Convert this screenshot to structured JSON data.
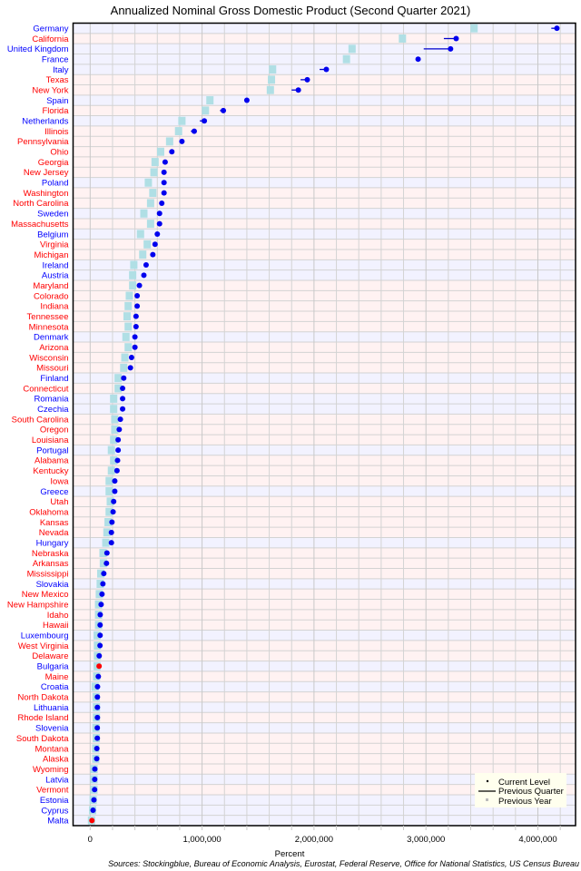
{
  "chart_data": {
    "type": "dot-range",
    "title": "Annualized Nominal Gross Domestic Product (Second Quarter 2021)",
    "xlabel": "Percent",
    "ylabel": "",
    "source": "Sources: Stockingblue, Bureau of Economic Analysis, Eurostat, Federal Reserve, Office for National Statistics, US Census Bureau",
    "xlim": [
      0,
      4300000
    ],
    "xticks": [
      0,
      1000000,
      2000000,
      3000000,
      4000000
    ],
    "xtick_labels": [
      "0",
      "1,000,000",
      "2,000,000",
      "3,000,000",
      "4,000,000"
    ],
    "grid": true,
    "grid_step": 200000,
    "legend": {
      "placement": "bottom-right",
      "items": [
        {
          "label": "Current Level",
          "symbol": "dot"
        },
        {
          "label": "Previous Quarter",
          "symbol": "line"
        },
        {
          "label": "Previous Year",
          "symbol": "square"
        }
      ]
    },
    "colors": {
      "country_label": "#0000ff",
      "state_label": "#ff0000",
      "country_band": "#f2f2ff",
      "state_band": "#fff2f2",
      "current_dot": "#0000ee",
      "current_dot_decline": "#ff0000",
      "previous_quarter_line": "#0000cc",
      "previous_year_square": "#b0dfe5",
      "grid": "#d3d3d3",
      "legend_bg": "#ffffee"
    },
    "series_names": [
      "Current Level",
      "Previous Quarter",
      "Previous Year"
    ],
    "rows": [
      {
        "name": "Germany",
        "kind": "country",
        "current": 4170000,
        "prev_quarter": 4120000,
        "prev_year": 3430000
      },
      {
        "name": "California",
        "kind": "state",
        "current": 3270000,
        "prev_quarter": 3160000,
        "prev_year": 2790000
      },
      {
        "name": "United Kingdom",
        "kind": "country",
        "current": 3220000,
        "prev_quarter": 2980000,
        "prev_year": 2340000
      },
      {
        "name": "France",
        "kind": "country",
        "current": 2930000,
        "prev_quarter": 2910000,
        "prev_year": 2290000
      },
      {
        "name": "Italy",
        "kind": "country",
        "current": 2110000,
        "prev_quarter": 2050000,
        "prev_year": 1630000
      },
      {
        "name": "Texas",
        "kind": "state",
        "current": 1940000,
        "prev_quarter": 1880000,
        "prev_year": 1620000
      },
      {
        "name": "New York",
        "kind": "state",
        "current": 1860000,
        "prev_quarter": 1800000,
        "prev_year": 1610000
      },
      {
        "name": "Spain",
        "kind": "country",
        "current": 1400000,
        "prev_quarter": 1390000,
        "prev_year": 1070000
      },
      {
        "name": "Florida",
        "kind": "state",
        "current": 1190000,
        "prev_quarter": 1160000,
        "prev_year": 1030000
      },
      {
        "name": "Netherlands",
        "kind": "country",
        "current": 1020000,
        "prev_quarter": 980000,
        "prev_year": 820000
      },
      {
        "name": "Illinois",
        "kind": "state",
        "current": 930000,
        "prev_quarter": 900000,
        "prev_year": 790000
      },
      {
        "name": "Pennsylvania",
        "kind": "state",
        "current": 820000,
        "prev_quarter": 810000,
        "prev_year": 710000
      },
      {
        "name": "Ohio",
        "kind": "state",
        "current": 730000,
        "prev_quarter": 720000,
        "prev_year": 630000
      },
      {
        "name": "Georgia",
        "kind": "state",
        "current": 670000,
        "prev_quarter": 660000,
        "prev_year": 580000
      },
      {
        "name": "New Jersey",
        "kind": "state",
        "current": 660000,
        "prev_quarter": 655000,
        "prev_year": 570000
      },
      {
        "name": "Poland",
        "kind": "country",
        "current": 660000,
        "prev_quarter": 655000,
        "prev_year": 520000
      },
      {
        "name": "Washington",
        "kind": "state",
        "current": 660000,
        "prev_quarter": 650000,
        "prev_year": 560000
      },
      {
        "name": "North Carolina",
        "kind": "state",
        "current": 640000,
        "prev_quarter": 630000,
        "prev_year": 540000
      },
      {
        "name": "Sweden",
        "kind": "country",
        "current": 620000,
        "prev_quarter": 615000,
        "prev_year": 480000
      },
      {
        "name": "Massachusetts",
        "kind": "state",
        "current": 620000,
        "prev_quarter": 610000,
        "prev_year": 540000
      },
      {
        "name": "Belgium",
        "kind": "country",
        "current": 600000,
        "prev_quarter": 595000,
        "prev_year": 450000
      },
      {
        "name": "Virginia",
        "kind": "state",
        "current": 580000,
        "prev_quarter": 575000,
        "prev_year": 510000
      },
      {
        "name": "Michigan",
        "kind": "state",
        "current": 560000,
        "prev_quarter": 540000,
        "prev_year": 470000
      },
      {
        "name": "Ireland",
        "kind": "country",
        "current": 500000,
        "prev_quarter": 495000,
        "prev_year": 390000
      },
      {
        "name": "Austria",
        "kind": "country",
        "current": 480000,
        "prev_quarter": 475000,
        "prev_year": 380000
      },
      {
        "name": "Maryland",
        "kind": "state",
        "current": 440000,
        "prev_quarter": 435000,
        "prev_year": 380000
      },
      {
        "name": "Colorado",
        "kind": "state",
        "current": 420000,
        "prev_quarter": 415000,
        "prev_year": 350000
      },
      {
        "name": "Indiana",
        "kind": "state",
        "current": 420000,
        "prev_quarter": 415000,
        "prev_year": 340000
      },
      {
        "name": "Tennessee",
        "kind": "state",
        "current": 410000,
        "prev_quarter": 405000,
        "prev_year": 330000
      },
      {
        "name": "Minnesota",
        "kind": "state",
        "current": 410000,
        "prev_quarter": 405000,
        "prev_year": 340000
      },
      {
        "name": "Denmark",
        "kind": "country",
        "current": 400000,
        "prev_quarter": 395000,
        "prev_year": 320000
      },
      {
        "name": "Arizona",
        "kind": "state",
        "current": 400000,
        "prev_quarter": 395000,
        "prev_year": 340000
      },
      {
        "name": "Wisconsin",
        "kind": "state",
        "current": 370000,
        "prev_quarter": 365000,
        "prev_year": 310000
      },
      {
        "name": "Missouri",
        "kind": "state",
        "current": 360000,
        "prev_quarter": 355000,
        "prev_year": 300000
      },
      {
        "name": "Finland",
        "kind": "country",
        "current": 300000,
        "prev_quarter": 297000,
        "prev_year": 250000
      },
      {
        "name": "Connecticut",
        "kind": "state",
        "current": 290000,
        "prev_quarter": 287000,
        "prev_year": 250000
      },
      {
        "name": "Romania",
        "kind": "country",
        "current": 290000,
        "prev_quarter": 287000,
        "prev_year": 210000
      },
      {
        "name": "Czechia",
        "kind": "country",
        "current": 290000,
        "prev_quarter": 287000,
        "prev_year": 210000
      },
      {
        "name": "South Carolina",
        "kind": "state",
        "current": 270000,
        "prev_quarter": 267000,
        "prev_year": 220000
      },
      {
        "name": "Oregon",
        "kind": "state",
        "current": 260000,
        "prev_quarter": 257000,
        "prev_year": 220000
      },
      {
        "name": "Louisiana",
        "kind": "state",
        "current": 250000,
        "prev_quarter": 247000,
        "prev_year": 210000
      },
      {
        "name": "Portugal",
        "kind": "country",
        "current": 250000,
        "prev_quarter": 247000,
        "prev_year": 190000
      },
      {
        "name": "Alabama",
        "kind": "state",
        "current": 245000,
        "prev_quarter": 242000,
        "prev_year": 210000
      },
      {
        "name": "Kentucky",
        "kind": "state",
        "current": 240000,
        "prev_quarter": 237000,
        "prev_year": 190000
      },
      {
        "name": "Iowa",
        "kind": "state",
        "current": 220000,
        "prev_quarter": 217000,
        "prev_year": 170000
      },
      {
        "name": "Greece",
        "kind": "country",
        "current": 220000,
        "prev_quarter": 217000,
        "prev_year": 170000
      },
      {
        "name": "Utah",
        "kind": "state",
        "current": 210000,
        "prev_quarter": 207000,
        "prev_year": 180000
      },
      {
        "name": "Oklahoma",
        "kind": "state",
        "current": 205000,
        "prev_quarter": 202000,
        "prev_year": 170000
      },
      {
        "name": "Kansas",
        "kind": "state",
        "current": 195000,
        "prev_quarter": 192000,
        "prev_year": 160000
      },
      {
        "name": "Nevada",
        "kind": "state",
        "current": 190000,
        "prev_quarter": 187000,
        "prev_year": 150000
      },
      {
        "name": "Hungary",
        "kind": "country",
        "current": 190000,
        "prev_quarter": 187000,
        "prev_year": 140000
      },
      {
        "name": "Nebraska",
        "kind": "state",
        "current": 150000,
        "prev_quarter": 148000,
        "prev_year": 115000
      },
      {
        "name": "Arkansas",
        "kind": "state",
        "current": 146000,
        "prev_quarter": 144000,
        "prev_year": 118000
      },
      {
        "name": "Mississippi",
        "kind": "state",
        "current": 122000,
        "prev_quarter": 120000,
        "prev_year": 95000
      },
      {
        "name": "Slovakia",
        "kind": "country",
        "current": 114000,
        "prev_quarter": 112000,
        "prev_year": 90000
      },
      {
        "name": "New Mexico",
        "kind": "state",
        "current": 106000,
        "prev_quarter": 104000,
        "prev_year": 82000
      },
      {
        "name": "New Hampshire",
        "kind": "state",
        "current": 98000,
        "prev_quarter": 96000,
        "prev_year": 75000
      },
      {
        "name": "Idaho",
        "kind": "state",
        "current": 90000,
        "prev_quarter": 88000,
        "prev_year": 75000
      },
      {
        "name": "Hawaii",
        "kind": "state",
        "current": 89000,
        "prev_quarter": 87000,
        "prev_year": 75000
      },
      {
        "name": "Luxembourg",
        "kind": "country",
        "current": 89000,
        "prev_quarter": 87000,
        "prev_year": 63000
      },
      {
        "name": "West Virginia",
        "kind": "state",
        "current": 88000,
        "prev_quarter": 86000,
        "prev_year": 65000
      },
      {
        "name": "Delaware",
        "kind": "state",
        "current": 81000,
        "prev_quarter": 79000,
        "prev_year": 65000
      },
      {
        "name": "Bulgaria",
        "kind": "country",
        "current": 80000,
        "prev_quarter": 81000,
        "prev_year": 63000,
        "decline": true
      },
      {
        "name": "Maine",
        "kind": "state",
        "current": 73000,
        "prev_quarter": 71000,
        "prev_year": 58000
      },
      {
        "name": "Croatia",
        "kind": "country",
        "current": 66000,
        "prev_quarter": 65000,
        "prev_year": 45000
      },
      {
        "name": "North Dakota",
        "kind": "state",
        "current": 65000,
        "prev_quarter": 64000,
        "prev_year": 53000
      },
      {
        "name": "Lithuania",
        "kind": "country",
        "current": 65000,
        "prev_quarter": 64000,
        "prev_year": 56000
      },
      {
        "name": "Rhode Island",
        "kind": "state",
        "current": 65000,
        "prev_quarter": 64000,
        "prev_year": 56000
      },
      {
        "name": "Slovenia",
        "kind": "country",
        "current": 64000,
        "prev_quarter": 63000,
        "prev_year": 52000
      },
      {
        "name": "South Dakota",
        "kind": "state",
        "current": 64000,
        "prev_quarter": 63000,
        "prev_year": 55000
      },
      {
        "name": "Montana",
        "kind": "state",
        "current": 60000,
        "prev_quarter": 59000,
        "prev_year": 50000
      },
      {
        "name": "Alaska",
        "kind": "state",
        "current": 59000,
        "prev_quarter": 58000,
        "prev_year": 50000
      },
      {
        "name": "Wyoming",
        "kind": "state",
        "current": 42000,
        "prev_quarter": 41000,
        "prev_year": 35000
      },
      {
        "name": "Latvia",
        "kind": "country",
        "current": 41000,
        "prev_quarter": 40000,
        "prev_year": 34000
      },
      {
        "name": "Vermont",
        "kind": "state",
        "current": 40000,
        "prev_quarter": 39000,
        "prev_year": 34000
      },
      {
        "name": "Estonia",
        "kind": "country",
        "current": 34000,
        "prev_quarter": 33000,
        "prev_year": 27000
      },
      {
        "name": "Cyprus",
        "kind": "country",
        "current": 26000,
        "prev_quarter": 25500,
        "prev_year": 22000
      },
      {
        "name": "Malta",
        "kind": "country",
        "current": 16000,
        "prev_quarter": 16500,
        "prev_year": 12000,
        "decline": true
      }
    ]
  }
}
